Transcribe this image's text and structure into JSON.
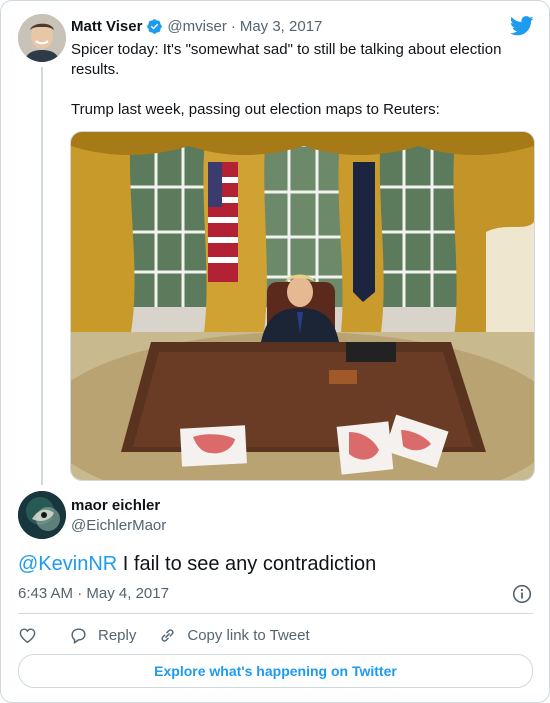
{
  "parent_tweet": {
    "author_name": "Matt Viser",
    "author_handle": "@mviser",
    "separator": "·",
    "date": "May 3, 2017",
    "paragraphs": [
      "Spicer today: It's \"somewhat sad\" to still be talking about election results.",
      "Trump last week, passing out election maps to Reuters:"
    ],
    "photo_icon": "oval-office-photo"
  },
  "main_tweet": {
    "author_name": "maor eichler",
    "author_handle": "@EichlerMaor",
    "mention": "@KevinNR",
    "text": " I fail to see any contradiction",
    "time": "6:43 AM",
    "separator": "·",
    "date": "May 4, 2017"
  },
  "actions": {
    "like_icon": "heart-icon",
    "reply_label": "Reply",
    "copy_label": "Copy link to Tweet"
  },
  "explore_label": "Explore what's happening on Twitter",
  "colors": {
    "accent": "#1d9bf0",
    "muted": "#536471",
    "border": "#cfd9de",
    "text": "#0f1419"
  }
}
